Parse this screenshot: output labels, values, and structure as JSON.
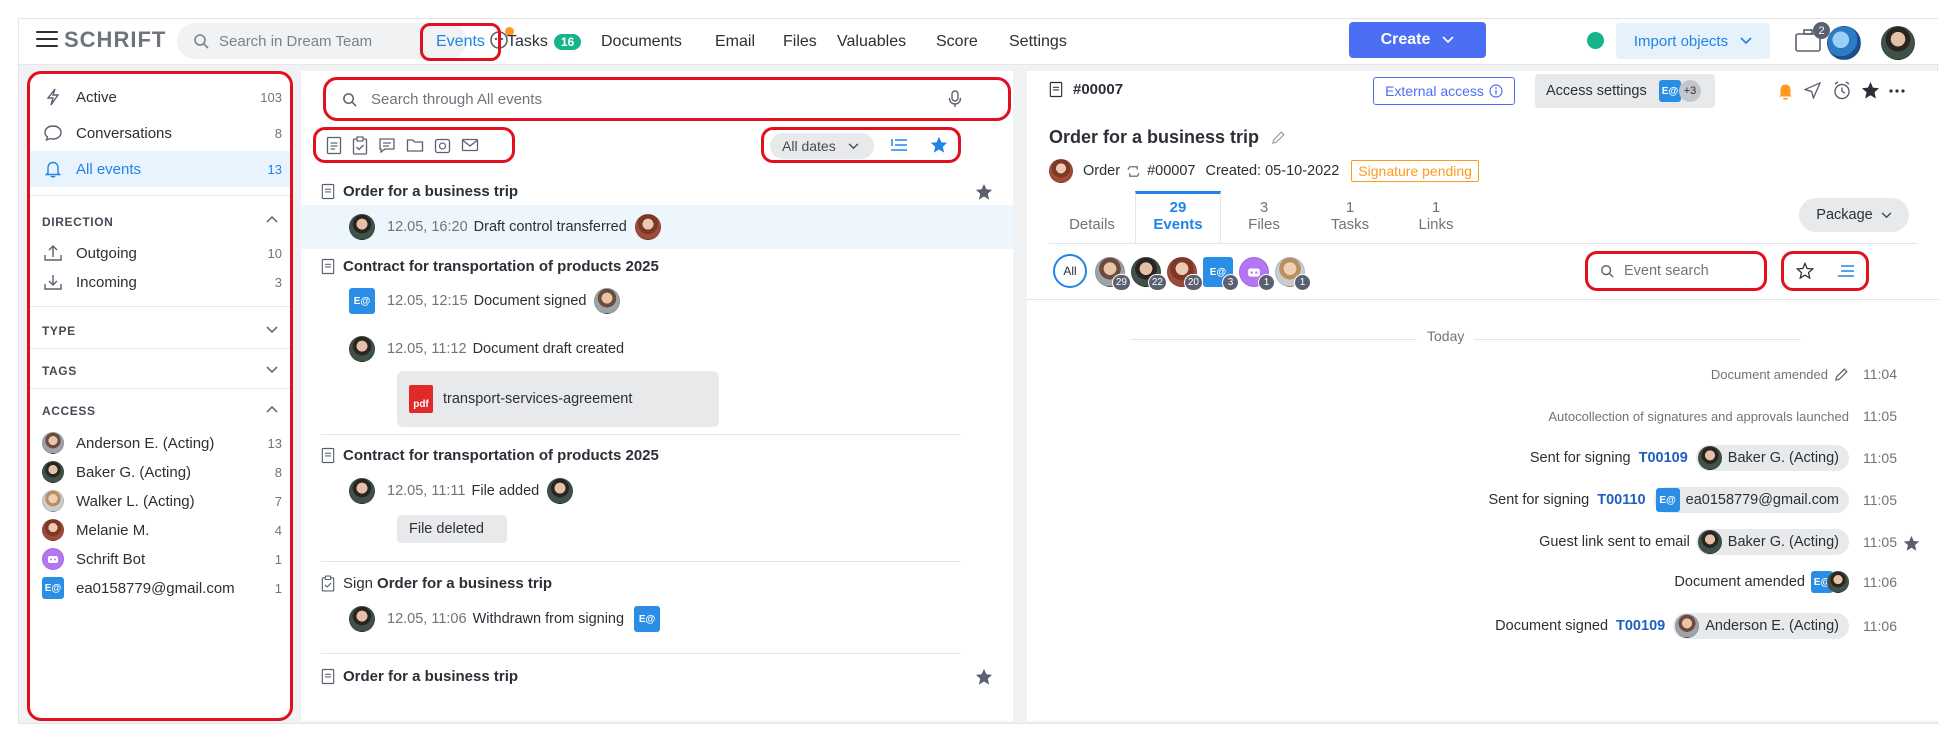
{
  "topbar": {
    "logo": "SCHRIFT",
    "search_placeholder": "Search in Dream Team",
    "nav": {
      "events": "Events",
      "tasks": "Tasks",
      "tasks_badge": "16",
      "documents": "Documents",
      "email": "Email",
      "files": "Files",
      "valuables": "Valuables",
      "score": "Score",
      "settings": "Settings"
    },
    "create_label": "Create",
    "import_label": "Import objects",
    "case_count": "2"
  },
  "sidebar": {
    "quick": [
      {
        "label": "Active",
        "count": "103"
      },
      {
        "label": "Conversations",
        "count": "8"
      },
      {
        "label": "All events",
        "count": "13"
      }
    ],
    "direction_header": "DIRECTION",
    "direction": [
      {
        "label": "Outgoing",
        "count": "10"
      },
      {
        "label": "Incoming",
        "count": "3"
      }
    ],
    "type_header": "TYPE",
    "tags_header": "TAGS",
    "access_header": "ACCESS",
    "access": [
      {
        "label": "Anderson E. (Acting)",
        "count": "13"
      },
      {
        "label": "Baker G. (Acting)",
        "count": "8"
      },
      {
        "label": "Walker L. (Acting)",
        "count": "7"
      },
      {
        "label": "Melanie M.",
        "count": "4"
      },
      {
        "label": "Schrift Bot",
        "count": "1"
      },
      {
        "label": "ea0158779@gmail.com",
        "count": "1"
      }
    ]
  },
  "events_list": {
    "search_placeholder": "Search through All events",
    "dates_label": "All dates",
    "email_badge": "E@",
    "groups": [
      {
        "title": "Order for a business trip",
        "rows": [
          {
            "time": "12.05, 16:20",
            "text": "Draft control transferred"
          }
        ]
      },
      {
        "title": "Contract for transportation of products 2025",
        "rows": [
          {
            "time": "12.05, 12:15",
            "text": "Document signed"
          },
          {
            "time": "12.05, 11:12",
            "text": "Document draft created"
          }
        ],
        "file": "transport-services-agreement",
        "file_type": "pdf"
      },
      {
        "title": "Contract for transportation of products 2025",
        "rows": [
          {
            "time": "12.05, 11:11",
            "text": "File added"
          }
        ],
        "chip": "File deleted"
      },
      {
        "prefix": "Sign",
        "title": "Order for a business trip",
        "rows": [
          {
            "time": "12.05, 11:06",
            "text": "Withdrawn from signing"
          }
        ]
      },
      {
        "title": "Order for a business trip"
      }
    ]
  },
  "detail": {
    "id": "#00007",
    "external_access": "External access",
    "access_settings": "Access settings",
    "access_more": "+3",
    "title": "Order for a business trip",
    "meta_type": "Order",
    "meta_id": "#00007",
    "meta_created": "Created: 05-10-2022",
    "status": "Signature pending",
    "tabs": [
      {
        "count": "",
        "label": "Details"
      },
      {
        "count": "29",
        "label": "Events"
      },
      {
        "count": "3",
        "label": "Files"
      },
      {
        "count": "1",
        "label": "Tasks"
      },
      {
        "count": "1",
        "label": "Links"
      }
    ],
    "package_label": "Package",
    "all_label": "All",
    "participant_counts": [
      "29",
      "22",
      "20",
      "3",
      "1",
      "1"
    ],
    "event_search_placeholder": "Event search",
    "today_label": "Today",
    "feed": [
      {
        "text": "Document amended",
        "time": "11:04"
      },
      {
        "text": "Autocollection of signatures and approvals launched",
        "time": "11:05"
      },
      {
        "text": "Sent for signing",
        "code": "T00109",
        "person": "Baker G. (Acting)",
        "time": "11:05"
      },
      {
        "text": "Sent for signing",
        "code": "T00110",
        "person": "ea0158779@gmail.com",
        "time": "11:05"
      },
      {
        "text": "Guest link sent to email",
        "person": "Baker G. (Acting)",
        "time": "11:05"
      },
      {
        "text": "Document amended",
        "time": "11:06"
      },
      {
        "text": "Document signed",
        "code": "T00109",
        "person": "Anderson E. (Acting)",
        "time": "11:06"
      }
    ]
  },
  "colors": {
    "accent": "#1f84e6",
    "create": "#4b6ef5",
    "highlight": "#e0101e",
    "status_pending": "#ff9a1f",
    "online": "#17b48b"
  }
}
